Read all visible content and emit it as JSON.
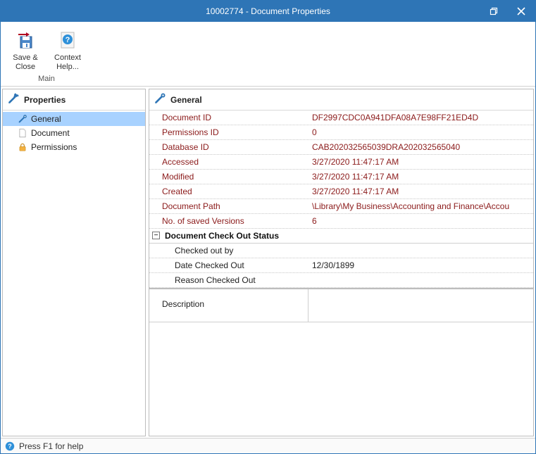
{
  "window": {
    "title": "10002774 - Document Properties"
  },
  "ribbon": {
    "group_label": "Main",
    "items": [
      {
        "label": "Save & Close"
      },
      {
        "label": "Context Help..."
      }
    ]
  },
  "sidebar": {
    "header": "Properties",
    "items": [
      {
        "label": "General"
      },
      {
        "label": "Document"
      },
      {
        "label": "Permissions"
      }
    ]
  },
  "main": {
    "header": "General",
    "rows": [
      {
        "label": "Document ID",
        "value": "DF2997CDC0A941DFA08A7E98FF21ED4D"
      },
      {
        "label": "Permissions ID",
        "value": "0"
      },
      {
        "label": "Database ID",
        "value": "CAB202032565039DRA202032565040"
      },
      {
        "label": "Accessed",
        "value": "3/27/2020 11:47:17 AM"
      },
      {
        "label": "Modified",
        "value": "3/27/2020 11:47:17 AM"
      },
      {
        "label": "Created",
        "value": "3/27/2020 11:47:17 AM"
      },
      {
        "label": "Document Path",
        "value": "\\Library\\My Business\\Accounting and Finance\\Accou"
      },
      {
        "label": "No. of saved Versions",
        "value": "6"
      }
    ],
    "section": {
      "label": "Document Check Out Status",
      "rows": [
        {
          "label": "Checked out by",
          "value": ""
        },
        {
          "label": "Date Checked Out",
          "value": "12/30/1899"
        },
        {
          "label": "Reason Checked Out",
          "value": ""
        }
      ]
    },
    "description": {
      "label": "Description",
      "value": ""
    }
  },
  "statusbar": {
    "text": "Press F1 for help"
  }
}
